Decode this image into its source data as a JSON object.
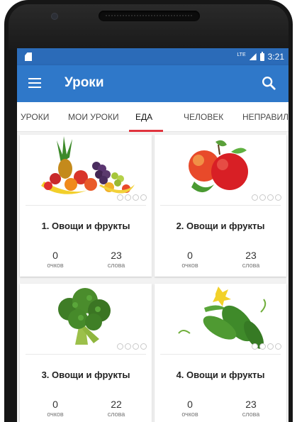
{
  "statusbar": {
    "network": "LTE",
    "time": "3:21"
  },
  "appbar": {
    "title": "Уроки",
    "menu_icon": "hamburger-menu-icon",
    "search_icon": "search-icon"
  },
  "colors": {
    "status": "#2b6bb8",
    "appbar": "#2f78c9",
    "tab_indicator": "#e0343e"
  },
  "tabs": [
    {
      "label": "УРОКИ"
    },
    {
      "label": "МОИ УРОКИ"
    },
    {
      "label": "ЕДА",
      "active": true
    },
    {
      "label": "ЧЕЛОВЕК"
    },
    {
      "label": "НЕПРАВИЛ"
    }
  ],
  "cards": [
    {
      "title": "1. Овощи и фрукты",
      "points": "0",
      "points_label": "очков",
      "words": "23",
      "words_label": "слова",
      "image": "fruit-basket"
    },
    {
      "title": "2. Овощи и фрукты",
      "points": "0",
      "points_label": "очков",
      "words": "23",
      "words_label": "слова",
      "image": "red-apples"
    },
    {
      "title": "3. Овощи и фрукты",
      "points": "0",
      "points_label": "очков",
      "words": "22",
      "words_label": "слова",
      "image": "broccoli"
    },
    {
      "title": "4. Овощи и фрукты",
      "points": "0",
      "points_label": "очков",
      "words": "23",
      "words_label": "слова",
      "image": "cucumbers"
    }
  ]
}
